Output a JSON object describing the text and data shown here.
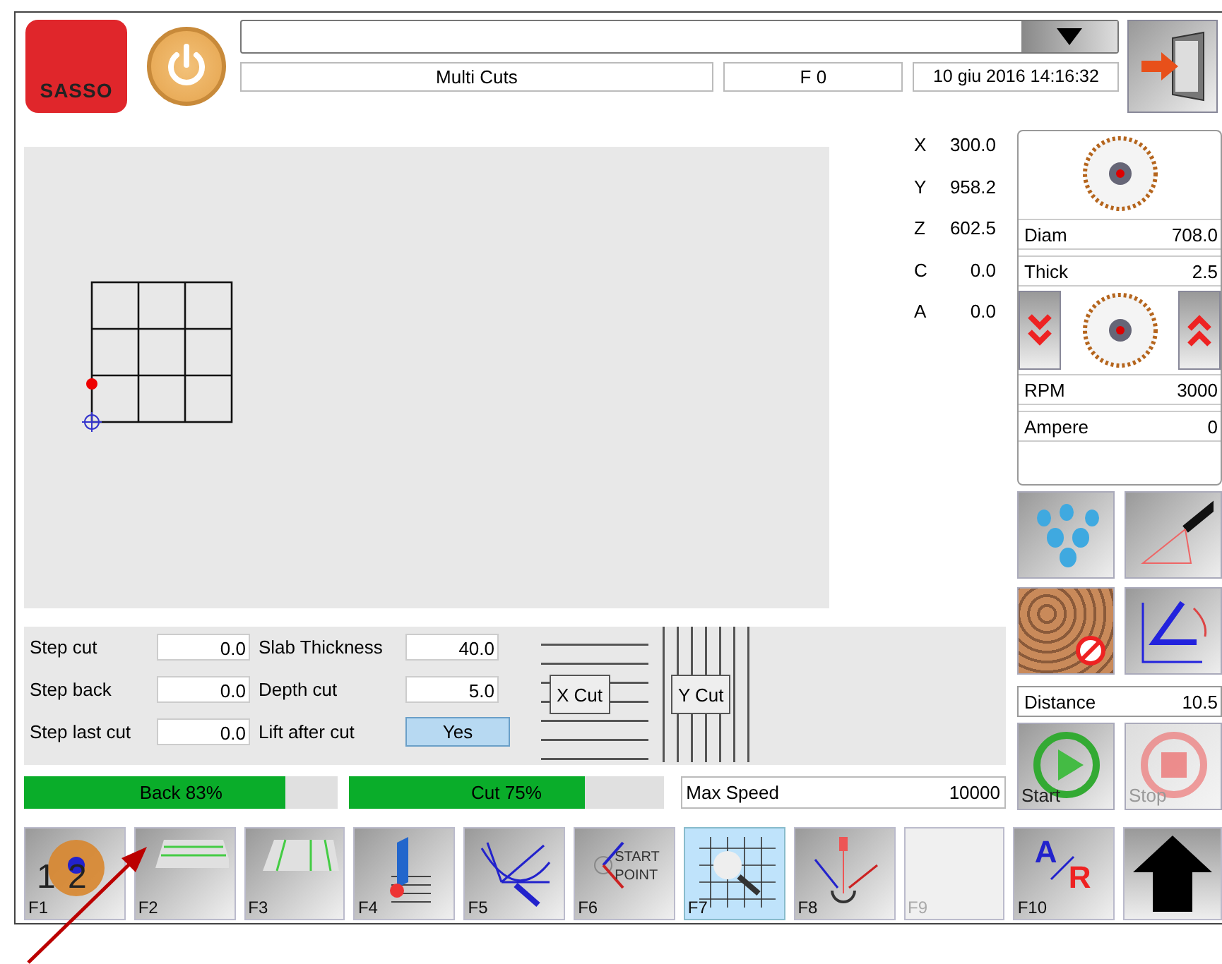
{
  "header": {
    "logo": "SASSO",
    "mode": "Multi Cuts",
    "program": "F 0",
    "datetime": "10 giu 2016 14:16:32"
  },
  "axes": [
    {
      "label": "X",
      "value": "300.0"
    },
    {
      "label": "Y",
      "value": "958.2"
    },
    {
      "label": "Z",
      "value": "602.5"
    },
    {
      "label": "C",
      "value": "0.0"
    },
    {
      "label": "A",
      "value": "0.0"
    }
  ],
  "blade": {
    "readings_top": [
      {
        "label": "Diam",
        "value": "708.0"
      },
      {
        "label": "Thick",
        "value": "2.5"
      }
    ],
    "readings_bottom": [
      {
        "label": "RPM",
        "value": "3000"
      },
      {
        "label": "Ampere",
        "value": "0"
      }
    ]
  },
  "params": [
    {
      "label": "Step cut",
      "value": "0.0",
      "kind": "field"
    },
    {
      "label": "Step back",
      "value": "0.0",
      "kind": "field"
    },
    {
      "label": "Step last cut",
      "value": "0.0",
      "kind": "field"
    },
    {
      "label": "Slab Thickness",
      "value": "40.0",
      "kind": "field"
    },
    {
      "label": "Depth cut",
      "value": "5.0",
      "kind": "field"
    },
    {
      "label": "Lift after cut",
      "value": "Yes",
      "kind": "toggle",
      "on": true
    }
  ],
  "cut_patterns": [
    {
      "label": "X Cut",
      "kind": "horizontal"
    },
    {
      "label": "Y Cut",
      "kind": "vertical"
    }
  ],
  "progress": [
    {
      "label": "Back 83%",
      "level": 0.83
    },
    {
      "label": "Cut 75%",
      "level": 0.75
    }
  ],
  "max_speed": {
    "label": "Max Speed",
    "value": "10000"
  },
  "distance": {
    "label": "Distance",
    "value": "10.5"
  },
  "run_buttons": [
    {
      "label": "Start",
      "kind": "start",
      "disabled": false
    },
    {
      "label": "Stop",
      "kind": "stop",
      "disabled": true
    }
  ],
  "function_keys": [
    {
      "label": "F1",
      "icon_text": [
        "1",
        "2"
      ],
      "selected": false,
      "disabled": false
    },
    {
      "label": "F2",
      "selected": false,
      "disabled": false
    },
    {
      "label": "F3",
      "selected": false,
      "disabled": false
    },
    {
      "label": "F4",
      "selected": false,
      "disabled": false
    },
    {
      "label": "F5",
      "selected": false,
      "disabled": false
    },
    {
      "label": "F6",
      "icon_text": [
        "START",
        "POINT"
      ],
      "selected": false,
      "disabled": false
    },
    {
      "label": "F7",
      "selected": true,
      "disabled": false
    },
    {
      "label": "F8",
      "selected": false,
      "disabled": false
    },
    {
      "label": "F9",
      "selected": false,
      "disabled": true
    },
    {
      "label": "F10",
      "icon_text": [
        "A",
        "R"
      ],
      "selected": false,
      "disabled": false
    }
  ]
}
